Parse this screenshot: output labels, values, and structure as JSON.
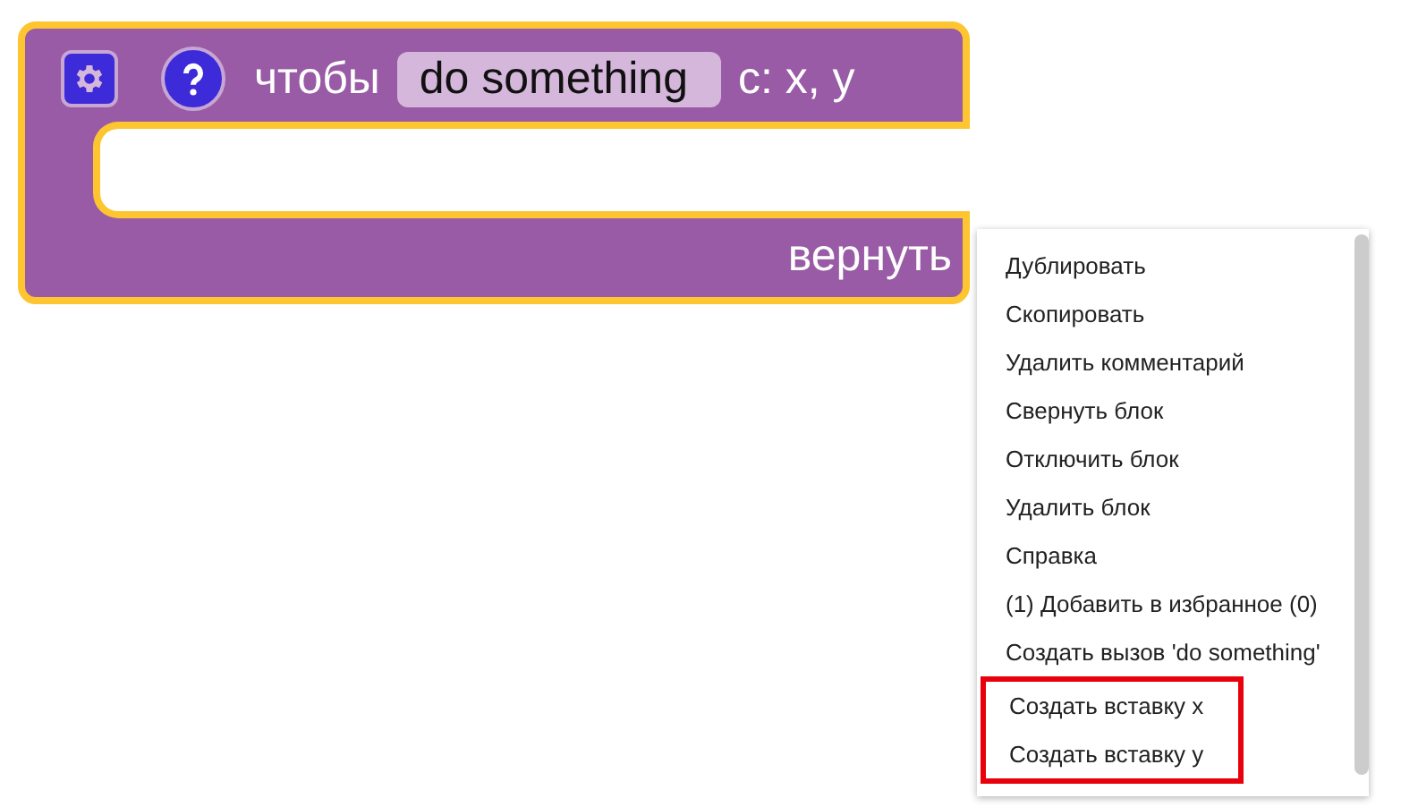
{
  "block": {
    "selected": true,
    "label": "чтобы",
    "name": "do something",
    "params": "с: x, y",
    "return_label": "вернуть"
  },
  "context_menu": {
    "items": [
      {
        "label": "Дублировать",
        "highlighted": false
      },
      {
        "label": "Скопировать",
        "highlighted": false
      },
      {
        "label": "Удалить комментарий",
        "highlighted": false
      },
      {
        "label": "Свернуть блок",
        "highlighted": false
      },
      {
        "label": "Отключить блок",
        "highlighted": false
      },
      {
        "label": "Удалить блок",
        "highlighted": false
      },
      {
        "label": "Справка",
        "highlighted": false
      },
      {
        "label": "(1) Добавить в избранное (0)",
        "highlighted": false
      },
      {
        "label": "Создать вызов 'do something'",
        "highlighted": false
      },
      {
        "label": "Создать вставку x",
        "highlighted": true
      },
      {
        "label": "Создать вставку y",
        "highlighted": true
      }
    ]
  }
}
